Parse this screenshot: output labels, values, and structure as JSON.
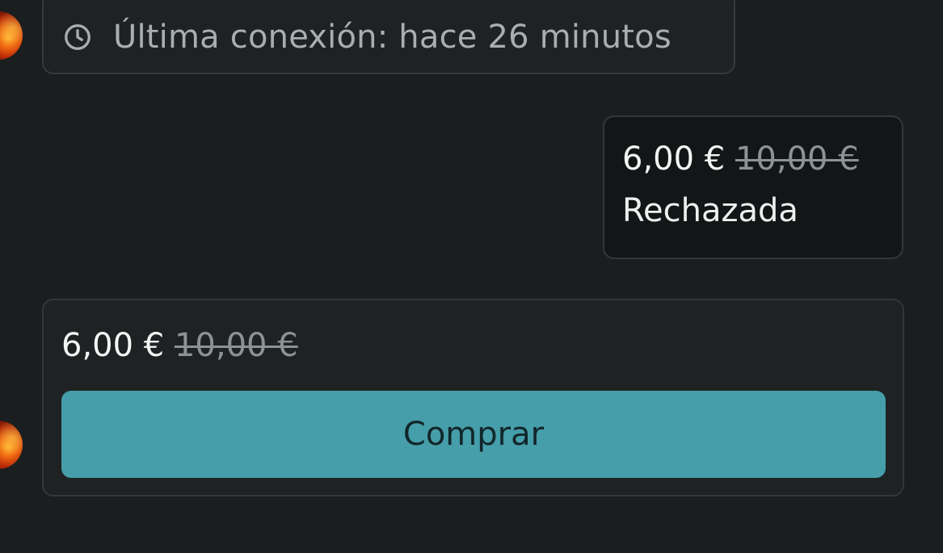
{
  "last_seen": {
    "icon": "clock-icon",
    "text": "Última conexión: hace 26 minutos"
  },
  "offer_sent": {
    "price_new": "6,00 €",
    "price_old": "10,00 €",
    "status": "Rechazada"
  },
  "offer_received": {
    "price_new": "6,00 €",
    "price_old": "10,00 €",
    "buy_label": "Comprar"
  },
  "colors": {
    "background": "#1b1e1f",
    "button": "#459ea9",
    "muted_text": "#a9aeb0"
  }
}
